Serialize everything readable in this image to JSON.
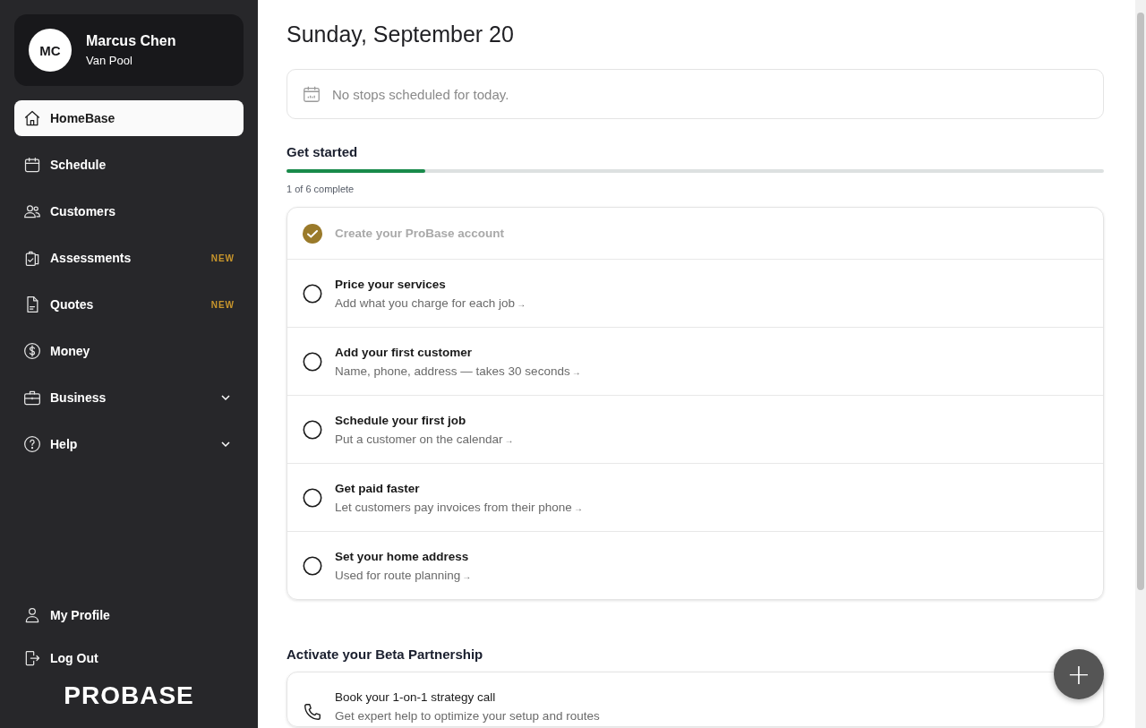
{
  "profile": {
    "initials": "MC",
    "name": "Marcus Chen",
    "company": "Van Pool"
  },
  "nav": [
    {
      "label": "HomeBase",
      "kind": "home",
      "selected": true,
      "expandable": false
    },
    {
      "label": "Schedule",
      "kind": "calendar",
      "selected": false,
      "expandable": false
    },
    {
      "label": "Customers",
      "kind": "people",
      "selected": false,
      "expandable": false
    },
    {
      "label": "Assessments",
      "kind": "clipboard",
      "selected": false,
      "badge": "NEW",
      "expandable": false
    },
    {
      "label": "Quotes",
      "kind": "document",
      "selected": false,
      "badge": "NEW",
      "expandable": false
    },
    {
      "label": "Money",
      "kind": "dollar",
      "selected": false,
      "expandable": false
    },
    {
      "label": "Business",
      "kind": "briefcase",
      "selected": false,
      "expandable": true
    },
    {
      "label": "Help",
      "kind": "help",
      "selected": false,
      "expandable": true
    }
  ],
  "bottom_nav": [
    {
      "label": "My Profile",
      "kind": "person"
    },
    {
      "label": "Log Out",
      "kind": "logout"
    }
  ],
  "logo": "PROBASE",
  "date": "Sunday, September 20",
  "stops_message": "No stops scheduled for today.",
  "get_started": {
    "title": "Get started",
    "level": 0.17,
    "progress_text": "1 of 6 complete",
    "steps": [
      {
        "title": "Create your ProBase account",
        "done": true
      },
      {
        "title": "Price your services",
        "subtitle": "Add what you charge for each job",
        "done": false
      },
      {
        "title": "Add your first customer",
        "subtitle": "Name, phone, address — takes 30 seconds",
        "done": false
      },
      {
        "title": "Schedule your first job",
        "subtitle": "Put a customer on the calendar",
        "done": false
      },
      {
        "title": "Get paid faster",
        "subtitle": "Let customers pay invoices from their phone",
        "done": false
      },
      {
        "title": "Set your home address",
        "subtitle": "Used for route planning",
        "done": false
      }
    ]
  },
  "beta": {
    "title": "Activate your Beta Partnership",
    "items": [
      {
        "title": "Book your 1-on-1 strategy call",
        "subtitle": "Get expert help to optimize your setup and routes"
      }
    ]
  },
  "fab": "+",
  "arrow": "→"
}
